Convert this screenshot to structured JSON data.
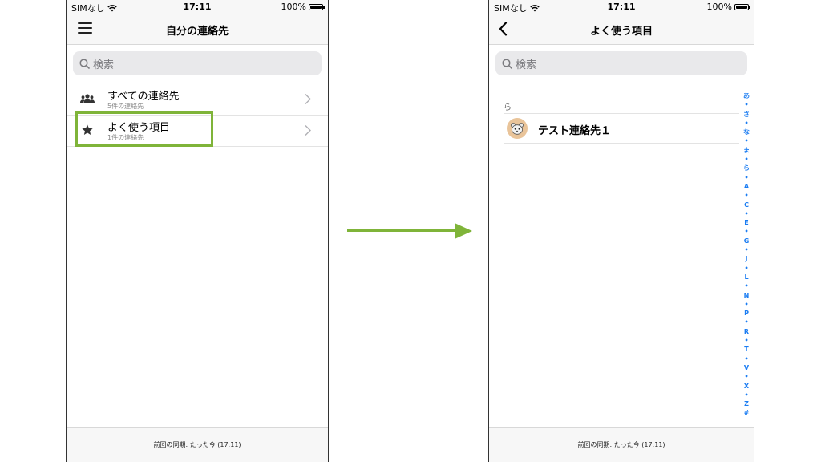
{
  "colors": {
    "accent_green": "#7fb439",
    "index_blue": "#1a7cf2"
  },
  "left_screen": {
    "status": {
      "carrier": "SIMなし",
      "time": "17:11",
      "battery": "100%"
    },
    "nav": {
      "title": "自分の連絡先",
      "icon": "hamburger-icon"
    },
    "search": {
      "placeholder": "検索"
    },
    "rows": [
      {
        "title": "すべての連絡先",
        "subtitle": "5件の連絡先",
        "icon": "people-icon"
      },
      {
        "title": "よく使う項目",
        "subtitle": "1件の連絡先",
        "icon": "star-icon"
      }
    ],
    "footer": "前回の同期: たった今 (17:11)"
  },
  "right_screen": {
    "status": {
      "carrier": "SIMなし",
      "time": "17:11",
      "battery": "100%"
    },
    "nav": {
      "title": "よく使う項目",
      "icon": "back-icon"
    },
    "search": {
      "placeholder": "検索"
    },
    "section_header": "ら",
    "contact": {
      "name": "テスト連絡先１",
      "avatar": "animal-avatar-icon"
    },
    "index": [
      "あ",
      "•",
      "さ",
      "•",
      "な",
      "•",
      "ま",
      "•",
      "ら",
      "•",
      "A",
      "•",
      "C",
      "•",
      "E",
      "•",
      "G",
      "•",
      "J",
      "•",
      "L",
      "•",
      "N",
      "•",
      "P",
      "•",
      "R",
      "•",
      "T",
      "•",
      "V",
      "•",
      "X",
      "•",
      "Z",
      "#"
    ],
    "footer": "前回の同期: たった今 (17:11)"
  }
}
